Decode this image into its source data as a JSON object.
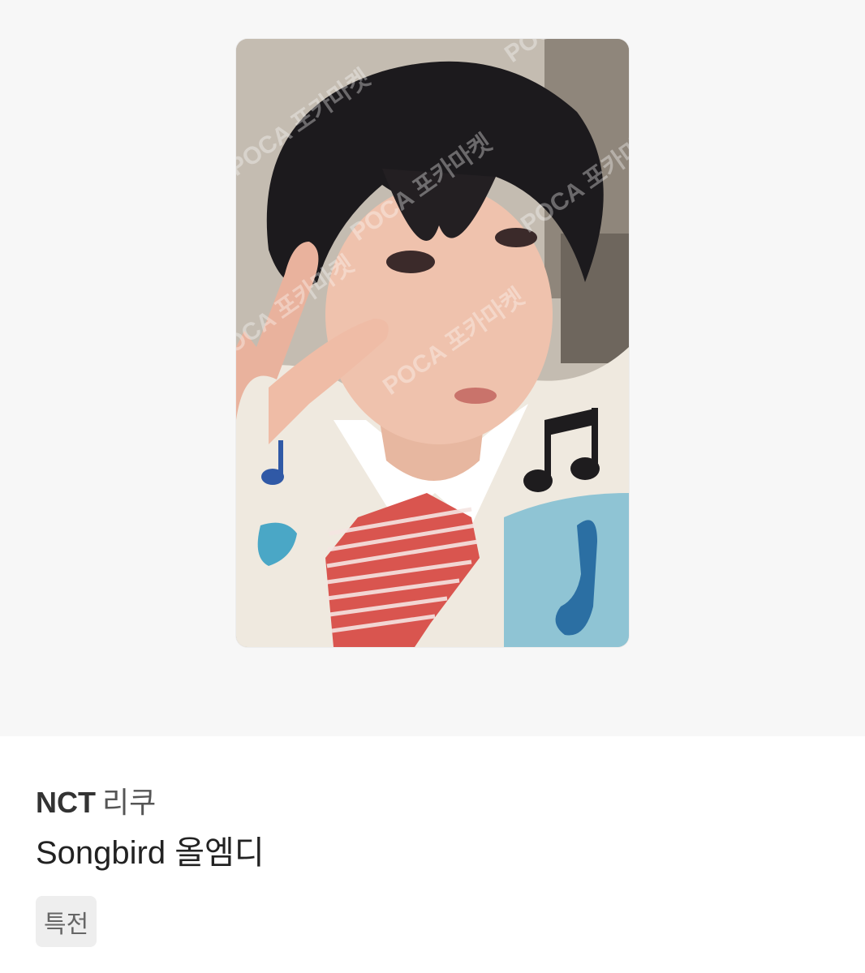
{
  "product": {
    "group": "NCT",
    "member": "리쿠",
    "title": "Songbird 올엠디",
    "tag": "특전"
  },
  "image": {
    "description_icon": "photocard-image",
    "watermark": "POCA 포카마켓"
  }
}
